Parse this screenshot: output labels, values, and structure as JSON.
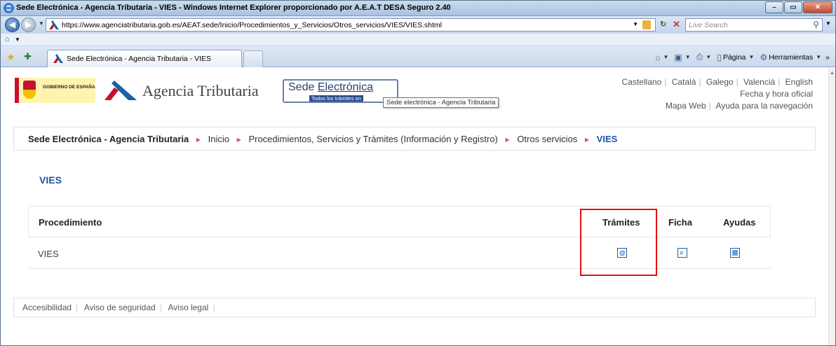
{
  "window": {
    "title": "Sede Electrónica - Agencia Tributaria - VIES - Windows Internet Explorer proporcionado por A.E.A.T DESA Seguro 2.40",
    "controls": {
      "minimize": "–",
      "maximize": "▭",
      "close": "✕"
    }
  },
  "addressbar": {
    "url": "https://www.agenciatributaria.gob.es/AEAT.sede/Inicio/Procedimientos_y_Servicios/Otros_servicios/VIES/VIES.shtml",
    "search_placeholder": "Live Search"
  },
  "tab": {
    "label": "Sede Electrónica - Agencia Tributaria - VIES"
  },
  "commandbar": {
    "page_label": "Página",
    "tools_label": "Herramientas",
    "more": "»"
  },
  "header": {
    "gobierno_text": "GOBIERNO DE ESPAÑA",
    "agency_name": "Agencia Tributaria",
    "sede_title_1": "Sede ",
    "sede_title_2": "Electrónica",
    "sede_subtitle": "Todos los trámites on",
    "tooltip": "Sede electrónica - Agencia Tributaria",
    "languages": [
      "Castellano",
      "Català",
      "Galego",
      "Valencià",
      "English"
    ],
    "fecha_link": "Fecha y hora oficial",
    "mapa_link": "Mapa Web",
    "ayuda_link": "Ayuda para la navegación"
  },
  "breadcrumb": {
    "home": "Sede Electrónica - Agencia Tributaria",
    "items": [
      "Inicio",
      "Procedimientos, Servicios y Trámites (Información y Registro)",
      "Otros servicios"
    ],
    "current": "VIES"
  },
  "main": {
    "heading": "VIES",
    "table": {
      "headers": {
        "procedimiento": "Procedimiento",
        "tramites": "Trámites",
        "ficha": "Ficha",
        "ayudas": "Ayudas"
      },
      "rows": [
        {
          "name": "VIES"
        }
      ]
    }
  },
  "footer": {
    "links": [
      "Accesibilidad",
      "Aviso de seguridad",
      "Aviso legal"
    ]
  },
  "colors": {
    "accent_blue": "#2055a3",
    "highlight_red": "#e01010",
    "breadcrumb_arrow": "#d9534f"
  }
}
